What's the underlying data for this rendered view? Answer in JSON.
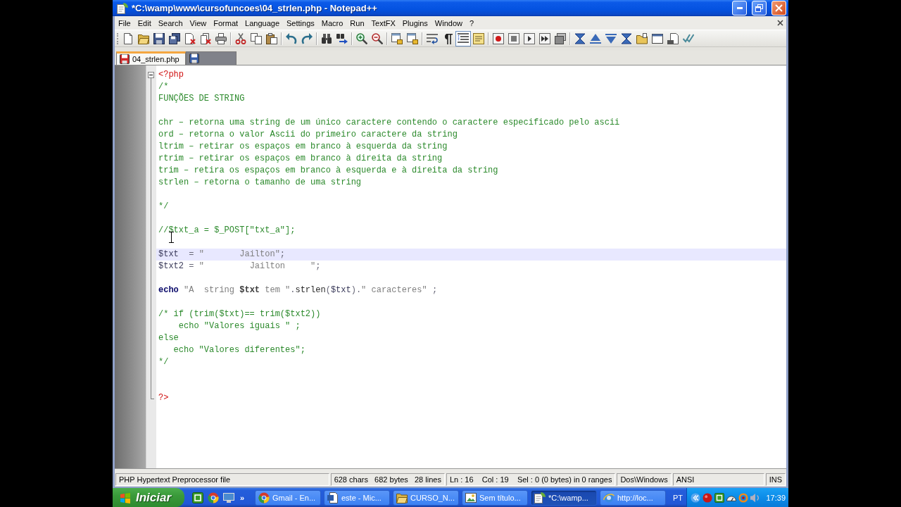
{
  "window": {
    "title": "*C:\\wamp\\www\\cursofuncoes\\04_strlen.php - Notepad++"
  },
  "menu": {
    "items": [
      "File",
      "Edit",
      "Search",
      "View",
      "Format",
      "Language",
      "Settings",
      "Macro",
      "Run",
      "TextFX",
      "Plugins",
      "Window",
      "?"
    ]
  },
  "toolbar": {
    "toggles": [
      {
        "on": false
      },
      {
        "on": false
      },
      {
        "on": true
      }
    ]
  },
  "tabs": [
    {
      "label": "04_strlen.php",
      "selected": true,
      "modified": true
    },
    {
      "selected": false,
      "modified": false
    }
  ],
  "editor": {
    "fold_expanded": true,
    "lines": [
      {
        "current": false,
        "tokens": [
          {
            "text": "<?php",
            "kind": "tag"
          }
        ]
      },
      {
        "current": false,
        "tokens": [
          {
            "text": "/*",
            "kind": "comment"
          }
        ]
      },
      {
        "current": false,
        "tokens": [
          {
            "text": "FUNÇÕES DE STRING",
            "kind": "comment"
          }
        ]
      },
      {
        "current": false
      },
      {
        "current": false,
        "tokens": [
          {
            "text": "chr – retorna uma string de um único caractere contendo o caractere especificado pelo ascii",
            "kind": "comment"
          }
        ]
      },
      {
        "current": false,
        "tokens": [
          {
            "text": "ord – retorna o valor Ascii do primeiro caractere da string",
            "kind": "comment"
          }
        ]
      },
      {
        "current": false,
        "tokens": [
          {
            "text": "ltrim – retirar os espaços em branco à esquerda da string",
            "kind": "comment"
          }
        ]
      },
      {
        "current": false,
        "tokens": [
          {
            "text": "rtrim – retirar os espaços em branco à direita da string",
            "kind": "comment"
          }
        ]
      },
      {
        "current": false,
        "tokens": [
          {
            "text": "trim – retira os espaços em branco à esquerda e à direita da string",
            "kind": "comment"
          }
        ]
      },
      {
        "current": false,
        "tokens": [
          {
            "text": "strlen – retorna o tamanho de uma string",
            "kind": "comment"
          }
        ]
      },
      {
        "current": false
      },
      {
        "current": false,
        "tokens": [
          {
            "text": "*/",
            "kind": "comment"
          }
        ]
      },
      {
        "current": false
      },
      {
        "current": false,
        "tokens": [
          {
            "text": "//$txt_a = $_POST[\"txt_a\"];",
            "kind": "comment"
          }
        ]
      },
      {
        "current": false
      },
      {
        "current": true,
        "tokens": [
          {
            "text": "$txt",
            "kind": "variable"
          },
          {
            "text": "  = ",
            "kind": "operator"
          },
          {
            "text": "\"       Jailton\"",
            "kind": "string"
          },
          {
            "text": ";",
            "kind": "operator"
          }
        ]
      },
      {
        "current": false,
        "tokens": [
          {
            "text": "$txt2",
            "kind": "variable"
          },
          {
            "text": " = ",
            "kind": "operator"
          },
          {
            "text": "\"         Jailton     \"",
            "kind": "string"
          },
          {
            "text": ";",
            "kind": "operator"
          }
        ]
      },
      {
        "current": false
      },
      {
        "current": false,
        "tokens": [
          {
            "text": "echo",
            "kind": "keyword"
          },
          {
            "text": " \"A  string ",
            "kind": "string"
          },
          {
            "text": "$txt",
            "kind": "interpolated"
          },
          {
            "text": " tem \"",
            "kind": "string"
          },
          {
            "text": ".",
            "kind": "operator"
          },
          {
            "text": "strlen",
            "kind": "function"
          },
          {
            "text": "(",
            "kind": "operator"
          },
          {
            "text": "$txt",
            "kind": "variable"
          },
          {
            "text": ").",
            "kind": "operator"
          },
          {
            "text": "\" caracteres\"",
            "kind": "string"
          },
          {
            "text": " ;",
            "kind": "operator"
          }
        ]
      },
      {
        "current": false
      },
      {
        "current": false,
        "tokens": [
          {
            "text": "/* if (trim($txt)== trim($txt2))",
            "kind": "comment"
          }
        ]
      },
      {
        "current": false,
        "tokens": [
          {
            "text": "    echo \"Valores iguais \" ;",
            "kind": "comment"
          }
        ]
      },
      {
        "current": false,
        "tokens": [
          {
            "text": "else",
            "kind": "comment"
          }
        ]
      },
      {
        "current": false,
        "tokens": [
          {
            "text": "   echo \"Valores diferentes\";",
            "kind": "comment"
          }
        ]
      },
      {
        "current": false,
        "tokens": [
          {
            "text": "*/",
            "kind": "comment"
          }
        ]
      },
      {
        "current": false
      },
      {
        "current": false
      },
      {
        "current": false,
        "tokens": [
          {
            "text": "?>",
            "kind": "tag"
          }
        ]
      }
    ]
  },
  "status_bar": {
    "file_type": "PHP Hypertext Preprocessor file",
    "stats": "628 chars   682 bytes   28 lines",
    "position": "Ln : 16    Col : 19    Sel : 0 (0 bytes) in 0 ranges",
    "eol": "Dos\\Windows",
    "encoding": "ANSI",
    "mode": "INS"
  },
  "taskbar": {
    "start": "Iniciar",
    "quick_launch_more": "»",
    "tasks": [
      {
        "label": "Gmail - En...",
        "selected": false
      },
      {
        "label": "este - Mic...",
        "selected": false
      },
      {
        "label": "CURSO_N...",
        "selected": false
      },
      {
        "label": "Sem título...",
        "selected": false
      },
      {
        "label": "*C:\\wamp...",
        "selected": true
      },
      {
        "label": "http://loc...",
        "selected": false
      }
    ],
    "language": "PT",
    "clock": "17:39"
  }
}
